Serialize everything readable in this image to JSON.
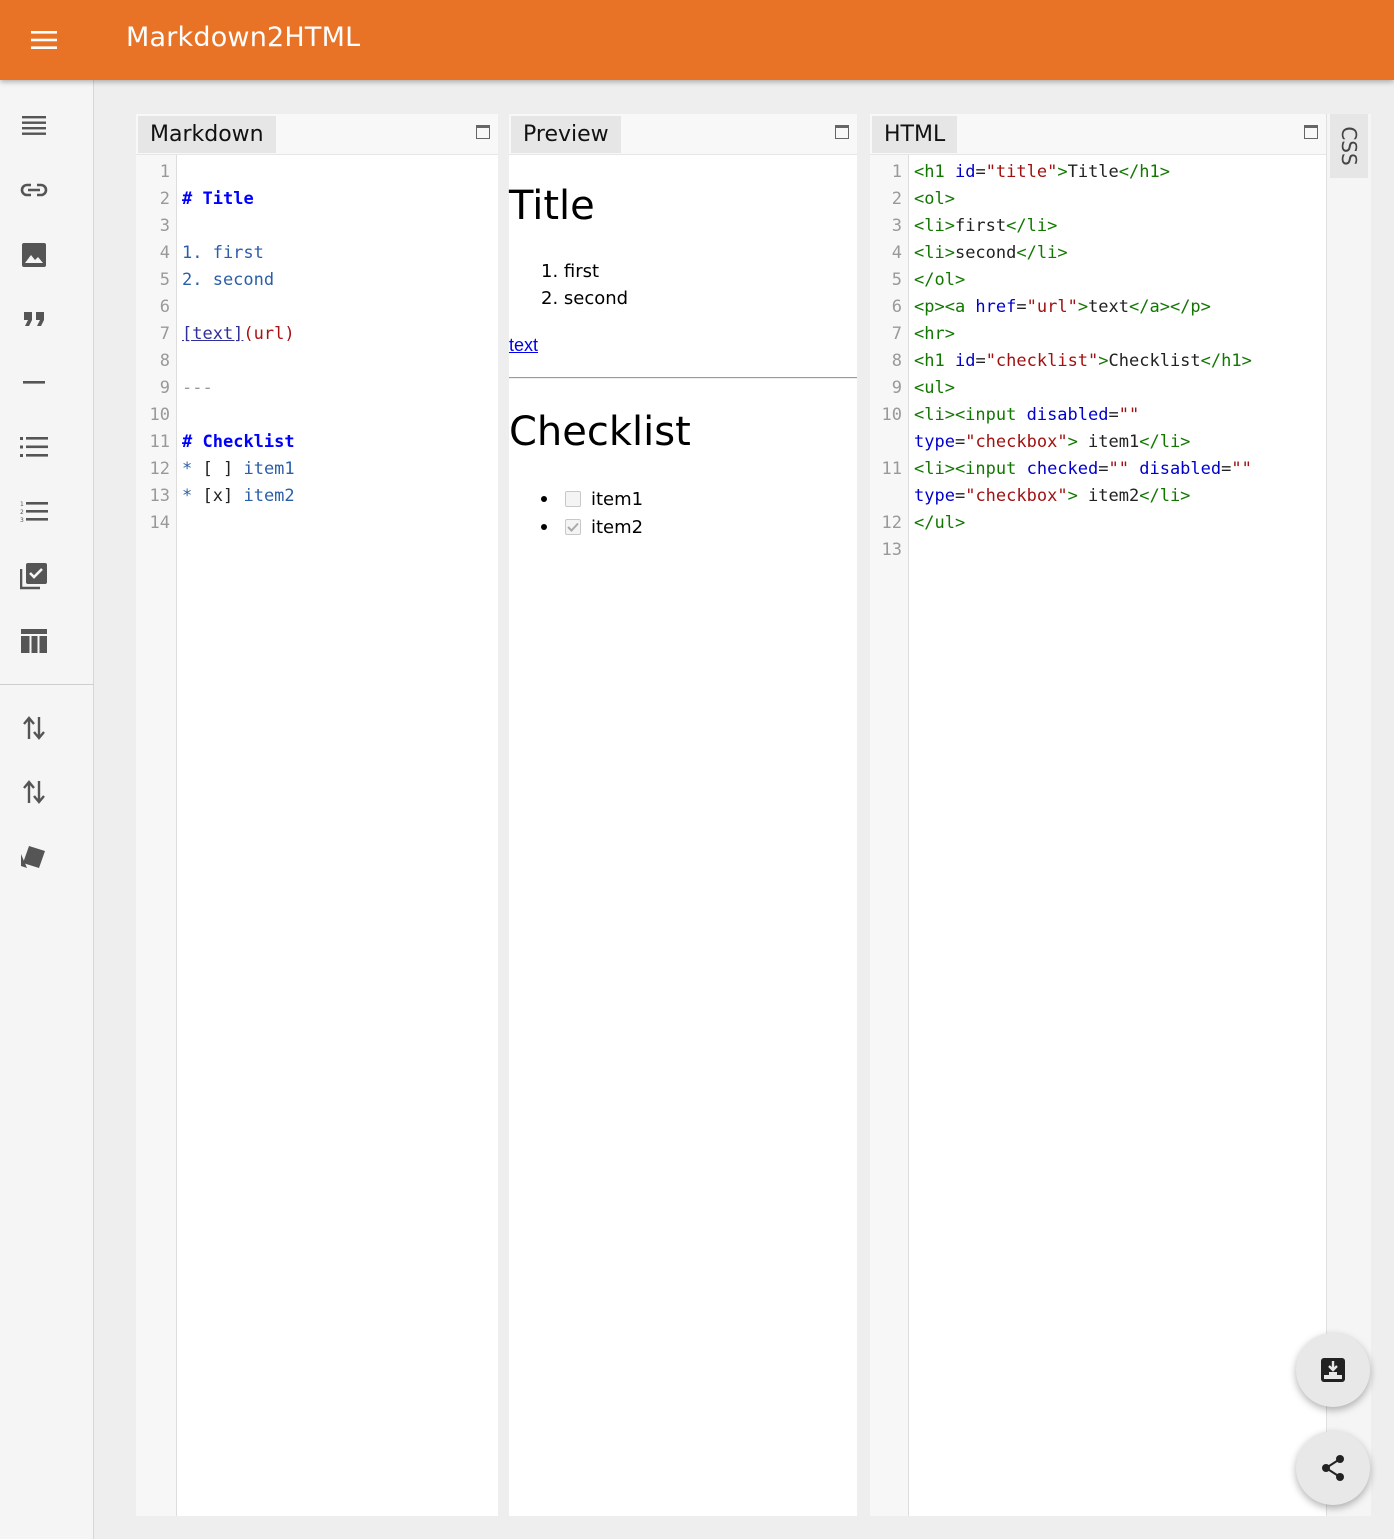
{
  "app": {
    "title": "Markdown2HTML"
  },
  "colors": {
    "appbar": "#e87326",
    "sidebar": "#f5f5f5",
    "background": "#eeeeee"
  },
  "sidebar": {
    "tools": [
      {
        "icon": "paragraph-icon"
      },
      {
        "icon": "link-icon"
      },
      {
        "icon": "image-icon"
      },
      {
        "icon": "quote-icon"
      },
      {
        "icon": "horizontal-rule-icon"
      },
      {
        "icon": "bulleted-list-icon"
      },
      {
        "icon": "numbered-list-icon"
      },
      {
        "icon": "checklist-icon"
      },
      {
        "icon": "table-icon"
      },
      {
        "icon": "import-export-icon"
      },
      {
        "icon": "swap-vertical-icon"
      },
      {
        "icon": "style-cards-icon"
      }
    ]
  },
  "panels": {
    "markdown": {
      "tab": "Markdown",
      "line_numbers": [
        "1",
        "2",
        "3",
        "4",
        "5",
        "6",
        "7",
        "8",
        "9",
        "10",
        "11",
        "12",
        "13",
        "14"
      ],
      "lines": {
        "l2a": "#",
        "l2b": "Title",
        "l4": "1. first",
        "l5": "2. second",
        "l7a": "[text]",
        "l7b": "(url)",
        "l9": "---",
        "l11a": "#",
        "l11b": "Checklist",
        "l12a": "*",
        "l12b": "[ ]",
        "l12c": "item1",
        "l13a": "*",
        "l13b": "[x]",
        "l13c": "item2"
      }
    },
    "preview": {
      "tab": "Preview",
      "h1_title": "Title",
      "ol": [
        "1. first",
        "2. second"
      ],
      "link": "text",
      "h1_checklist": "Checklist",
      "checklist": [
        {
          "label": "item1",
          "checked": false
        },
        {
          "label": "item2",
          "checked": true
        }
      ]
    },
    "html": {
      "tab": "HTML",
      "line_numbers": [
        "1",
        "2",
        "3",
        "4",
        "5",
        "6",
        "7",
        "8",
        "9",
        "10",
        "",
        "11",
        "",
        "12",
        "13"
      ]
    },
    "css": {
      "tab": "CSS"
    }
  },
  "fabs": [
    {
      "icon": "download-icon"
    },
    {
      "icon": "share-icon"
    }
  ]
}
